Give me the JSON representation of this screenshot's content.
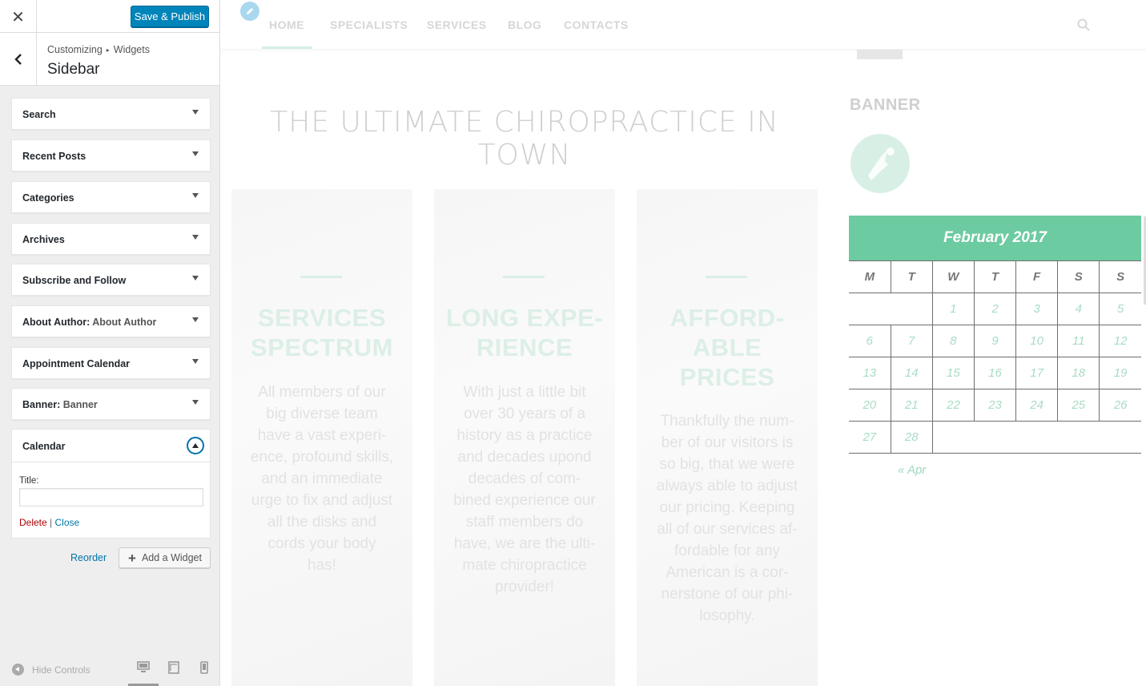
{
  "customizer": {
    "header": {
      "save_label": "Save & Publish"
    },
    "breadcrumb": {
      "root": "Customizing",
      "separator": "▸",
      "current": "Widgets"
    },
    "section_title": "Sidebar",
    "widgets": [
      {
        "label": "Search",
        "sub": ""
      },
      {
        "label": "Recent Posts",
        "sub": ""
      },
      {
        "label": "Categories",
        "sub": ""
      },
      {
        "label": "Archives",
        "sub": ""
      },
      {
        "label": "Subscribe and Follow",
        "sub": ""
      },
      {
        "label": "About Author:",
        "sub": "About Author"
      },
      {
        "label": "Appointment Calendar",
        "sub": ""
      },
      {
        "label": "Banner:",
        "sub": "Banner"
      }
    ],
    "open_widget": {
      "label": "Calendar",
      "field_label": "Title:",
      "field_value": "",
      "delete_label": "Delete",
      "action_separator": "|",
      "close_label": "Close"
    },
    "reorder_label": "Reorder",
    "add_widget_label": "Add a Widget",
    "footer": {
      "hide_controls_label": "Hide Controls"
    }
  },
  "site": {
    "nav": [
      "HOME",
      "SPECIALISTS",
      "SERVICES",
      "BLOG",
      "CONTACTS"
    ],
    "active_nav": "HOME",
    "hero_title": "THE ULTIMATE CHIROPRACTICE IN TOWN",
    "cards": [
      {
        "title": "SERVICES\nSPECTRUM",
        "text": "All members of our\nbig diverse team\nhave a vast experi-\nence, profound skills,\nand an immediate\nurge to fix and adjust\nall the disks and\ncords your body\nhas!"
      },
      {
        "title": "LONG EXPE-\nRIENCE",
        "text": "With just a little bit\nover 30 years of a\nhistory as a practice\nand decades upond\ndecades of com-\nbined experience our\nstaff members do\nhave, we are the ulti-\nmate chiropractice\nprovider!"
      },
      {
        "title": "AFFORD-\nABLE\nPRICES",
        "text": "Thankfully the num-\nber of our visitors is\nso big, that we were\nalways able to adjust\nour pricing. Keeping\nall of our services af-\nfordable for any\nAmerican is a cor-\nnerstone of our phi-\nlosophy."
      }
    ],
    "banner_title": "BANNER",
    "calendar": {
      "month": "February 2017",
      "weekdays": [
        "M",
        "T",
        "W",
        "T",
        "F",
        "S",
        "S"
      ],
      "weeks": [
        [
          "",
          "",
          "1",
          "2",
          "3",
          "4",
          "5"
        ],
        [
          "6",
          "7",
          "8",
          "9",
          "10",
          "11",
          "12"
        ],
        [
          "13",
          "14",
          "15",
          "16",
          "17",
          "18",
          "19"
        ],
        [
          "20",
          "21",
          "22",
          "23",
          "24",
          "25",
          "26"
        ],
        [
          "27",
          "28",
          "",
          "",
          "",
          "",
          ""
        ]
      ],
      "prev_link": "« Apr"
    }
  },
  "colors": {
    "publish_blue": "#0085ba",
    "link_blue": "#0073aa",
    "delete_red": "#aa0000",
    "calendar_green": "#6ccba0"
  },
  "icons": [
    "close-icon",
    "back-chevron-icon",
    "chevron-down-icon",
    "chevron-up-icon",
    "plus-icon",
    "pencil-icon",
    "search-icon",
    "desktop-icon",
    "tablet-icon",
    "mobile-icon",
    "arrow-left-circle-icon"
  ]
}
